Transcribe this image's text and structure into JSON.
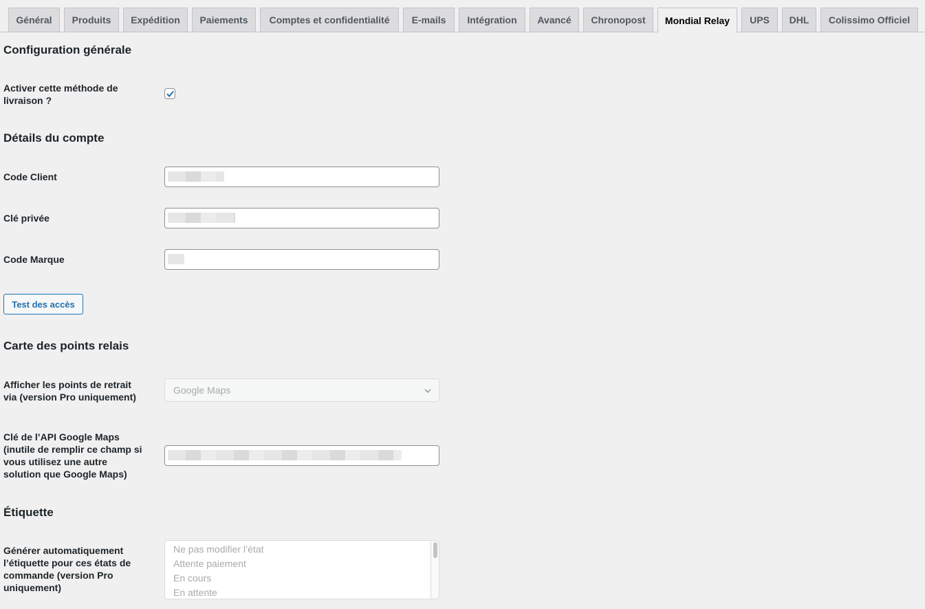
{
  "tabs": [
    {
      "label": "Général",
      "active": false
    },
    {
      "label": "Produits",
      "active": false
    },
    {
      "label": "Expédition",
      "active": false
    },
    {
      "label": "Paiements",
      "active": false
    },
    {
      "label": "Comptes et confidentialité",
      "active": false
    },
    {
      "label": "E-mails",
      "active": false
    },
    {
      "label": "Intégration",
      "active": false
    },
    {
      "label": "Avancé",
      "active": false
    },
    {
      "label": "Chronopost",
      "active": false
    },
    {
      "label": "Mondial Relay",
      "active": true
    },
    {
      "label": "UPS",
      "active": false
    },
    {
      "label": "DHL",
      "active": false
    },
    {
      "label": "Colissimo Officiel",
      "active": false
    }
  ],
  "general": {
    "title": "Configuration générale",
    "enable_label": "Activer cette méthode de livraison ?",
    "enable_checked": true
  },
  "account": {
    "title": "Détails du compte",
    "client_code_label": "Code Client",
    "private_key_label": "Clé privée",
    "brand_code_label": "Code Marque",
    "test_button": "Test des accès"
  },
  "map": {
    "title": "Carte des points relais",
    "display_label": "Afficher les points de retrait via (version Pro uniquement)",
    "display_value": "Google Maps",
    "api_key_label": "Clé de l’API Google Maps (inutile de remplir ce champ si vous utilisez une autre solution que Google Maps)"
  },
  "label": {
    "title": "Étiquette",
    "auto_label": "Générer automatiquement l’étiquette pour ces états de commande (version Pro uniquement)",
    "options": [
      "Ne pas modifier l’état",
      "Attente paiement",
      "En cours",
      "En attente"
    ]
  },
  "colors": {
    "accent": "#2271b1",
    "background": "#f0f0f1",
    "tab_inactive": "#dcdcde"
  }
}
